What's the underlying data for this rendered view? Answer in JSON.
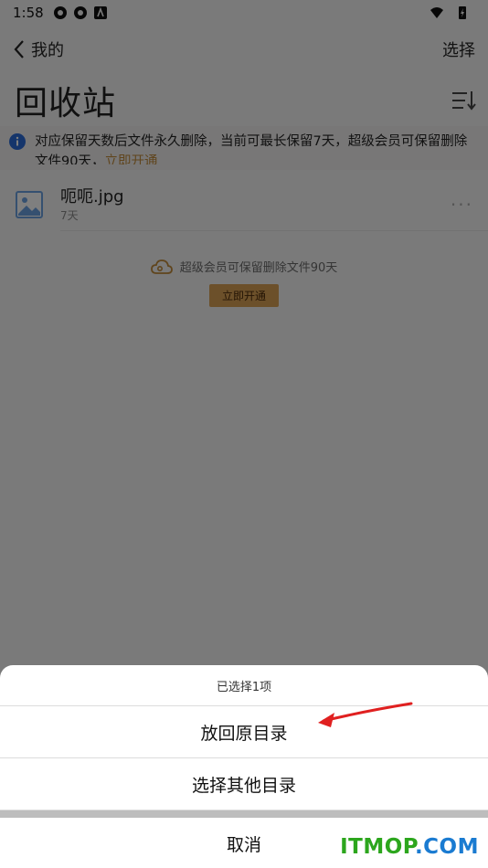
{
  "status_bar": {
    "time": "1:58"
  },
  "nav": {
    "back_label": "我的",
    "select_label": "选择"
  },
  "page": {
    "title": "回收站"
  },
  "notice": {
    "text": "对应保留天数后文件永久删除，当前可最长保留7天，超级会员可保留删除文件90天，",
    "link": "立即开通"
  },
  "file": {
    "name": "呃呃.jpg",
    "days": "7天"
  },
  "promo": {
    "text": "超级会员可保留删除文件90天",
    "button": "立即开通"
  },
  "sheet": {
    "header": "已选择1项",
    "options": [
      "放回原目录",
      "选择其他目录"
    ],
    "cancel": "取消"
  },
  "watermark": {
    "part1": "ITMOP",
    "part2": ".COM"
  },
  "colors": {
    "link": "#c08a3a",
    "promo_button": "#d8a055",
    "arrow": "#e02020",
    "watermark_green": "#2ca61d",
    "watermark_blue": "#1a7bd1"
  }
}
